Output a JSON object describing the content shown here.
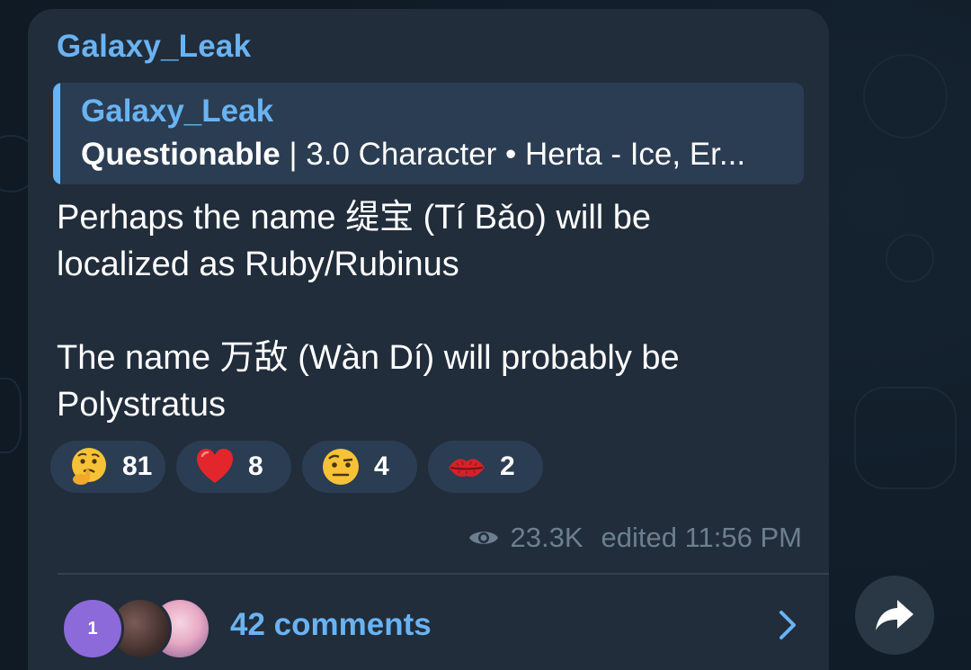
{
  "post": {
    "author": "Galaxy_Leak",
    "reply": {
      "author": "Galaxy_Leak",
      "bold_prefix": "Questionable",
      "text": " | 3.0 Character • Herta - Ice, Er..."
    },
    "message_lines": [
      "Perhaps the name 缇宝 (Tí Bǎo) will be",
      "localized as Ruby/Rubinus",
      "The name 万敌 (Wàn Dí) will probably be",
      "Polystratus"
    ],
    "reactions": [
      {
        "emoji": "thinking-face",
        "count": "81"
      },
      {
        "emoji": "red-heart",
        "count": "8"
      },
      {
        "emoji": "face-with-raised-eyebrow",
        "count": "4"
      },
      {
        "emoji": "kiss-mark",
        "count": "2"
      }
    ],
    "views": "23.3K",
    "edited_label": "edited 11:56 PM",
    "comments": {
      "avatar_badge": "1",
      "label": "42 comments"
    }
  },
  "colors": {
    "accent": "#6ab3f3",
    "bubble": "#212d3b",
    "reaction_bg": "#2b3d52",
    "meta_text": "#6d7f8f",
    "background": "#0f1a24"
  },
  "icons": {
    "views": "eye-icon",
    "comments_arrow": "chevron-right-icon",
    "share": "share-arrow-icon"
  }
}
